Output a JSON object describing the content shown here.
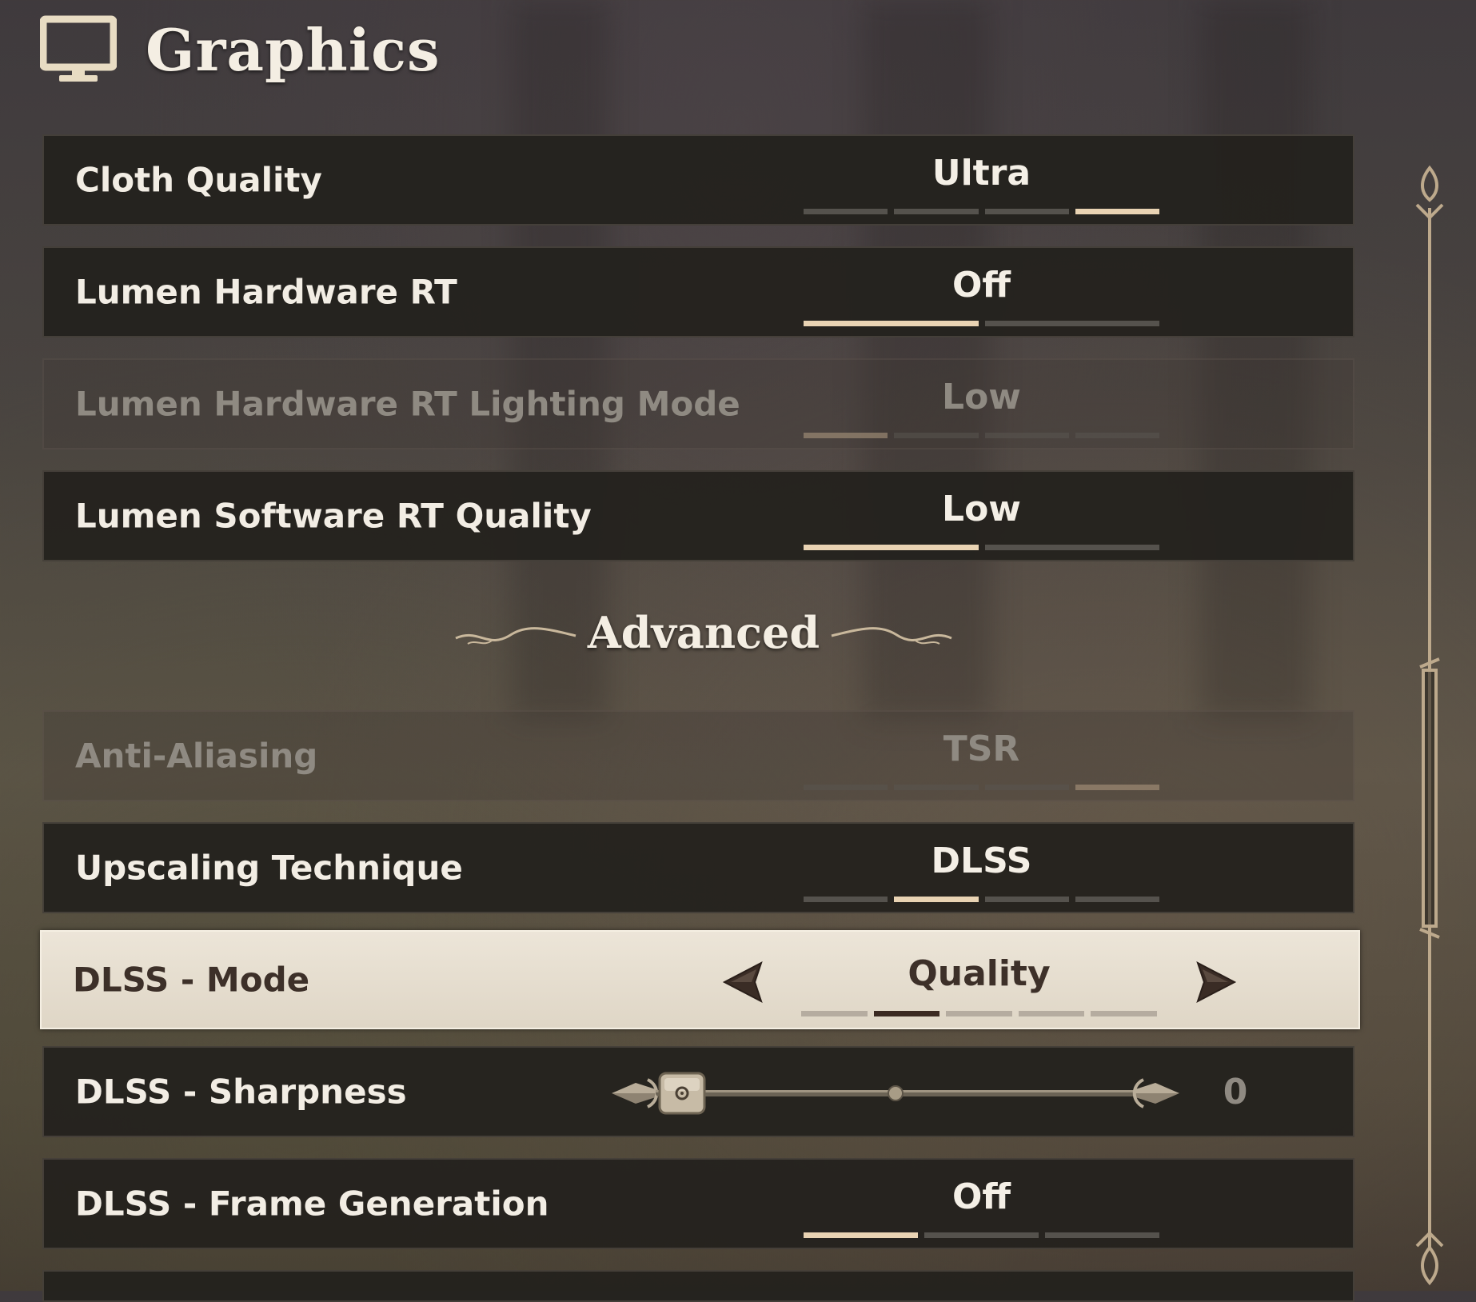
{
  "header": {
    "icon": "monitor-icon",
    "title": "Graphics"
  },
  "colors": {
    "accent": "#e9d3b3",
    "row_bg": "#24221e",
    "selected_bg": "#e6ddcf",
    "text": "#f2ede4",
    "disabled_text": "#8f8a82"
  },
  "settings": [
    {
      "label": "Cloth Quality",
      "value": "Ultra",
      "segments": 4,
      "active_segment": 4,
      "state": "normal"
    },
    {
      "label": "Lumen Hardware RT",
      "value": "Off",
      "segments": 2,
      "active_segment": 1,
      "state": "normal"
    },
    {
      "label": "Lumen Hardware RT Lighting Mode",
      "value": "Low",
      "segments": 4,
      "active_segment": 1,
      "state": "disabled"
    },
    {
      "label": "Lumen Software RT Quality",
      "value": "Low",
      "segments": 2,
      "active_segment": 1,
      "state": "normal"
    }
  ],
  "advanced": {
    "title": "Advanced",
    "settings": [
      {
        "label": "Anti-Aliasing",
        "value": "TSR",
        "segments": 4,
        "active_segment": 4,
        "state": "disabled"
      },
      {
        "label": "Upscaling Technique",
        "value": "DLSS",
        "segments": 4,
        "active_segment": 2,
        "state": "normal"
      },
      {
        "label": "DLSS - Mode",
        "value": "Quality",
        "segments": 5,
        "active_segment": 2,
        "state": "selected",
        "left_arrow": "arrow-left-icon",
        "right_arrow": "arrow-right-icon"
      },
      {
        "label": "DLSS - Sharpness",
        "value": "0",
        "slider_fraction": 0.0,
        "state": "normal",
        "control": "slider"
      },
      {
        "label": "DLSS - Frame Generation",
        "value": "Off",
        "segments": 3,
        "active_segment": 1,
        "state": "normal"
      }
    ]
  },
  "scrollbar": {
    "position_fraction": 0.6
  }
}
